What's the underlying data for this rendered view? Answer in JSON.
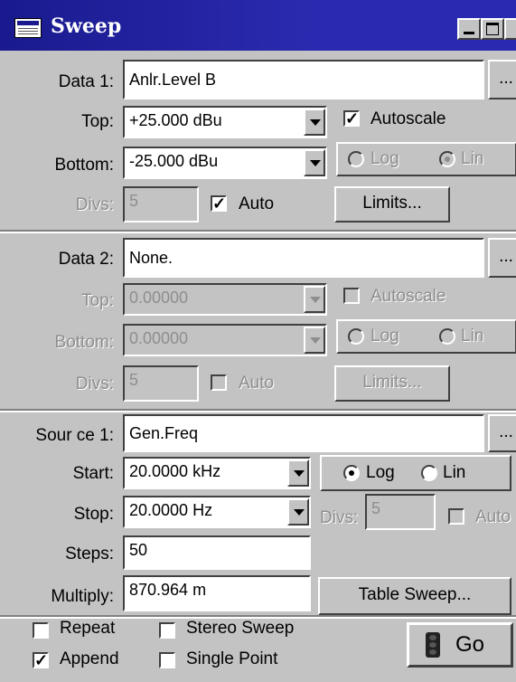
{
  "window": {
    "title": "Sweep"
  },
  "data1": {
    "label": "Data 1:",
    "value": "Anlr.Level B",
    "browse": "...",
    "top_label": "Top:",
    "top_value": "+25.000  dBu",
    "bottom_label": "Bottom:",
    "bottom_value": "-25.000  dBu",
    "autoscale_label": "Autoscale",
    "autoscale_checked": true,
    "log_label": "Log",
    "lin_label": "Lin",
    "divs_label": "Divs:",
    "divs_value": "5",
    "auto_label": "Auto",
    "auto_checked": true,
    "limits_label": "Limits..."
  },
  "data2": {
    "label": "Data 2:",
    "value": "None.",
    "browse": "...",
    "top_label": "Top:",
    "top_value": "0.00000",
    "bottom_label": "Bottom:",
    "bottom_value": "0.00000",
    "autoscale_label": "Autoscale",
    "log_label": "Log",
    "lin_label": "Lin",
    "divs_label": "Divs:",
    "divs_value": "5",
    "auto_label": "Auto",
    "limits_label": "Limits..."
  },
  "source1": {
    "label": "Sour ce 1:",
    "value": "Gen.Freq",
    "browse": "...",
    "start_label": "Start:",
    "start_value": "20.0000  kHz",
    "stop_label": "Stop:",
    "stop_value": "20.0000  Hz",
    "steps_label": "Steps:",
    "steps_value": "50",
    "multiply_label": "Multiply:",
    "multiply_value": "870.964  m",
    "log_label": "Log",
    "lin_label": "Lin",
    "log_selected": true,
    "divs_label": "Divs:",
    "divs_value": "5",
    "auto_label": "Auto",
    "table_sweep_label": "Table Sweep..."
  },
  "options": {
    "repeat_label": "Repeat",
    "stereo_sweep_label": "Stereo Sweep",
    "append_label": "Append",
    "single_point_label": "Single Point",
    "append_checked": true,
    "go_label": "Go"
  }
}
